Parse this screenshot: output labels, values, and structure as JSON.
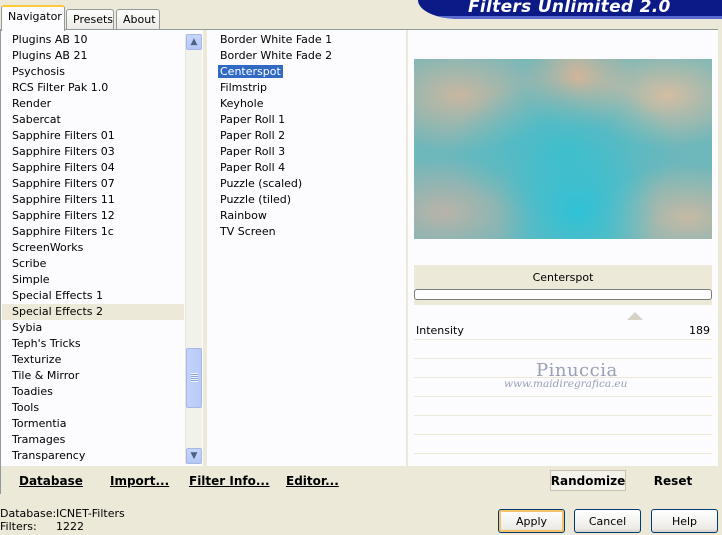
{
  "tabs": [
    "Navigator",
    "Presets",
    "About"
  ],
  "banner_title": "Filters Unlimited 2.0",
  "categories": [
    "Plugins AB 10",
    "Plugins AB 21",
    "Psychosis",
    "RCS Filter Pak 1.0",
    "Render",
    "Sabercat",
    "Sapphire Filters 01",
    "Sapphire Filters 03",
    "Sapphire Filters 04",
    "Sapphire Filters 07",
    "Sapphire Filters 11",
    "Sapphire Filters 12",
    "Sapphire Filters 1c",
    "ScreenWorks",
    "Scribe",
    "Simple",
    "Special Effects 1",
    "Special Effects 2",
    "Sybia",
    "Teph's Tricks",
    "Texturize",
    "Tile & Mirror",
    "Toadies",
    "Tools",
    "Tormentia",
    "Tramages",
    "Transparency"
  ],
  "selected_category": "Special Effects 2",
  "filters": [
    "Border White Fade 1",
    "Border White Fade 2",
    "Centerspot",
    "Filmstrip",
    "Keyhole",
    "Paper Roll 1",
    "Paper Roll 2",
    "Paper Roll 3",
    "Paper Roll 4",
    "Puzzle (scaled)",
    "Puzzle (tiled)",
    "Rainbow",
    "TV Screen"
  ],
  "selected_filter": "Centerspot",
  "links": {
    "database": "Database",
    "import": "Import...",
    "filter_info": "Filter Info...",
    "editor": "Editor..."
  },
  "preview_filter_name": "Centerspot",
  "param": {
    "label": "Intensity",
    "value": "189",
    "level": 189,
    "max": 255
  },
  "watermark": {
    "line1": "Pinuccia",
    "line2": "www.maidiregrafica.eu"
  },
  "randomize_label": "Randomize",
  "reset_label": "Reset",
  "footer": {
    "database_label": "Database:",
    "database_value": "ICNET-Filters",
    "filters_label": "Filters:",
    "filters_value": "1222"
  },
  "buttons": {
    "apply": "Apply",
    "cancel": "Cancel",
    "help": "Help"
  },
  "colors": {
    "selection": "#316ac5",
    "banner": "#0b1a86",
    "panel_bg": "#ece9d8"
  }
}
